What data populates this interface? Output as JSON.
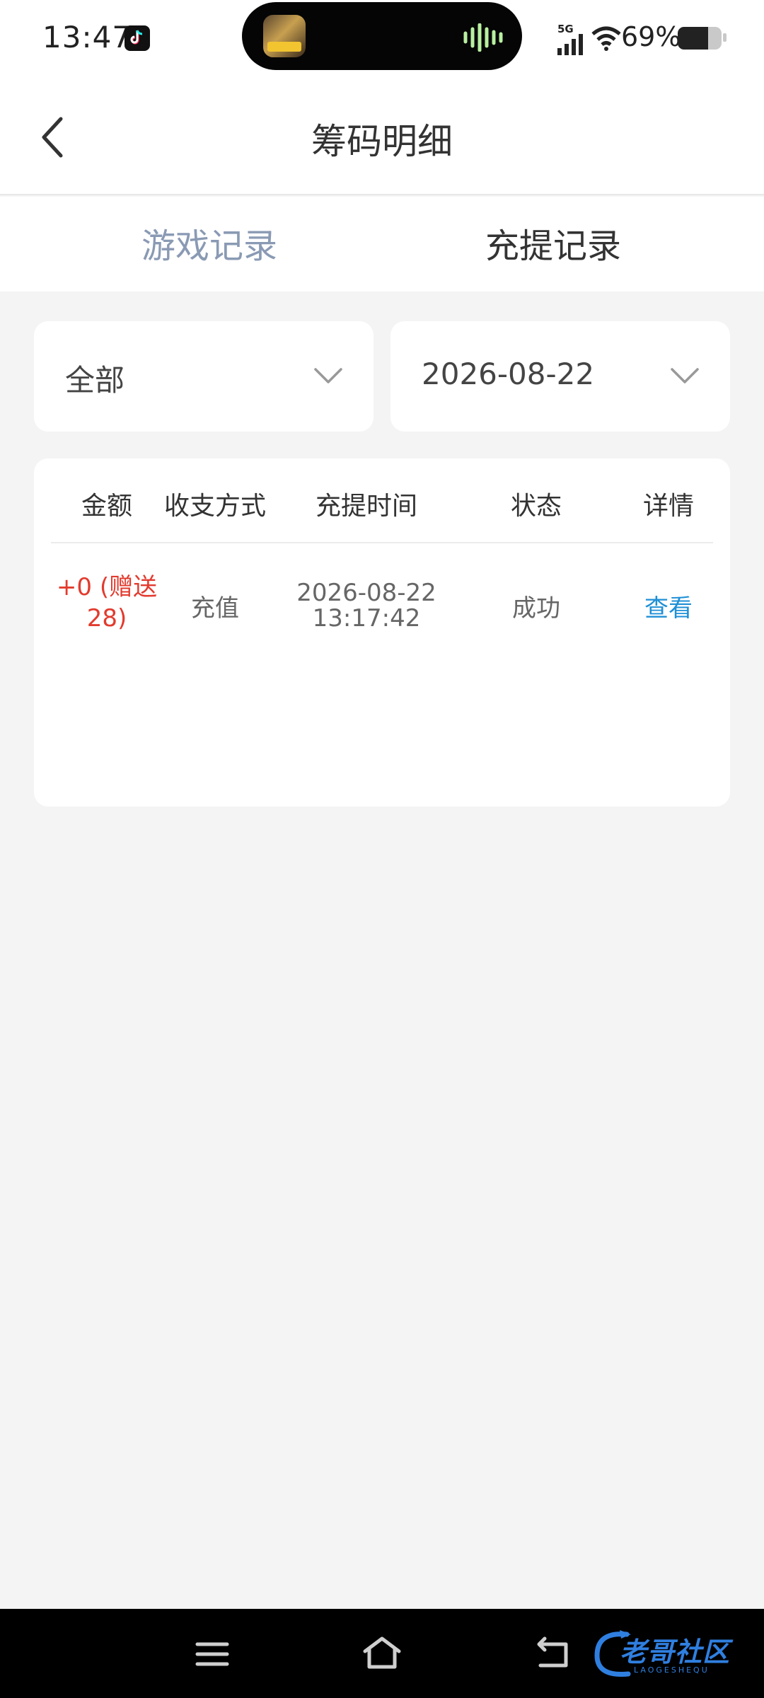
{
  "status_bar": {
    "time": "13:47",
    "network": "5G",
    "battery_percent": "69%",
    "battery_level": 0.69,
    "icons": [
      "tiktok-icon",
      "signal-icon",
      "wifi-icon",
      "battery-icon"
    ]
  },
  "header": {
    "title": "筹码明细",
    "back_icon": "chevron-left-icon"
  },
  "tabs": [
    {
      "label": "游戏记录",
      "active": false
    },
    {
      "label": "充提记录",
      "active": true
    }
  ],
  "filters": {
    "type": {
      "value": "全部"
    },
    "date": {
      "value": "2026-08-22"
    }
  },
  "table": {
    "columns": [
      "金额",
      "收支方式",
      "充提时间",
      "状态",
      "详情"
    ],
    "rows": [
      {
        "amount_line1": "+0 (赠送",
        "amount_line2": "28)",
        "method": "充值",
        "date": "2026-08-22",
        "time": "13:17:42",
        "status": "成功",
        "detail": "查看"
      }
    ]
  },
  "watermark": {
    "text": "老哥社区",
    "sub": "LAOGESHEQU"
  },
  "colors": {
    "amount": "#e23b2e",
    "link": "#1f8fd6",
    "inactive_tab": "#8a9ab4",
    "background": "#f4f4f4"
  }
}
